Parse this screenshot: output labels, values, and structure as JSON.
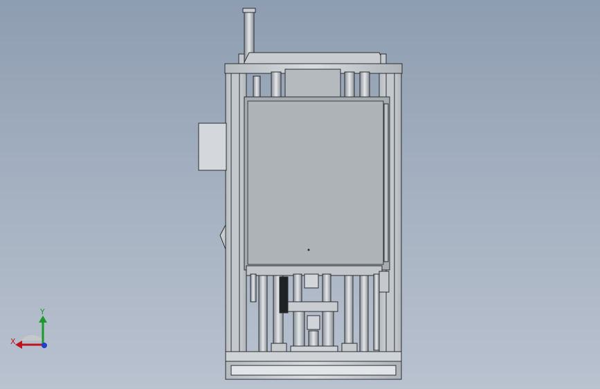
{
  "viewport": {
    "background_top": "#8e9db1",
    "background_bottom": "#b9c2cf",
    "model": "machine-front-view"
  },
  "triad": {
    "x_label": "X",
    "y_label": "Y",
    "x_color": "#c0141c",
    "y_color": "#1a9a2a",
    "z_color": "#1f3fd0"
  }
}
